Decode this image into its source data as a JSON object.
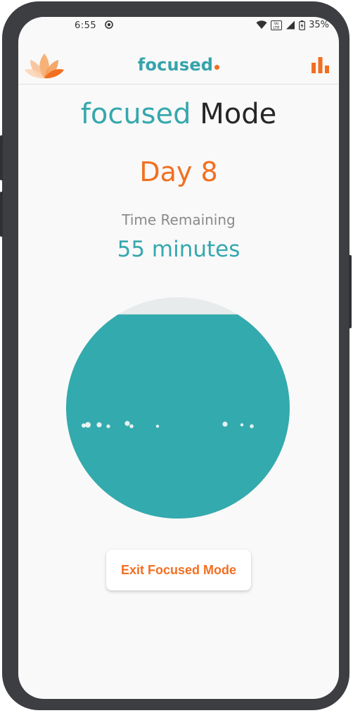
{
  "status_bar": {
    "time": "6:55",
    "battery": "35%",
    "network": "LTE",
    "network_sub": "Vo"
  },
  "header": {
    "brand": "focused",
    "icons": {
      "left": "lotus-icon",
      "right": "bar-chart-icon"
    }
  },
  "main": {
    "title_part1": "focused",
    "title_part2": "Mode",
    "day_label": "Day 8",
    "time_remaining_label": "Time Remaining",
    "time_remaining_value": "55 minutes",
    "progress_remaining_fraction": 0.92,
    "exit_button_label": "Exit Focused Mode"
  },
  "colors": {
    "teal": "#35a8ae",
    "orange": "#f26f21",
    "water": "#33aaad",
    "empty": "#e7ebeb"
  }
}
